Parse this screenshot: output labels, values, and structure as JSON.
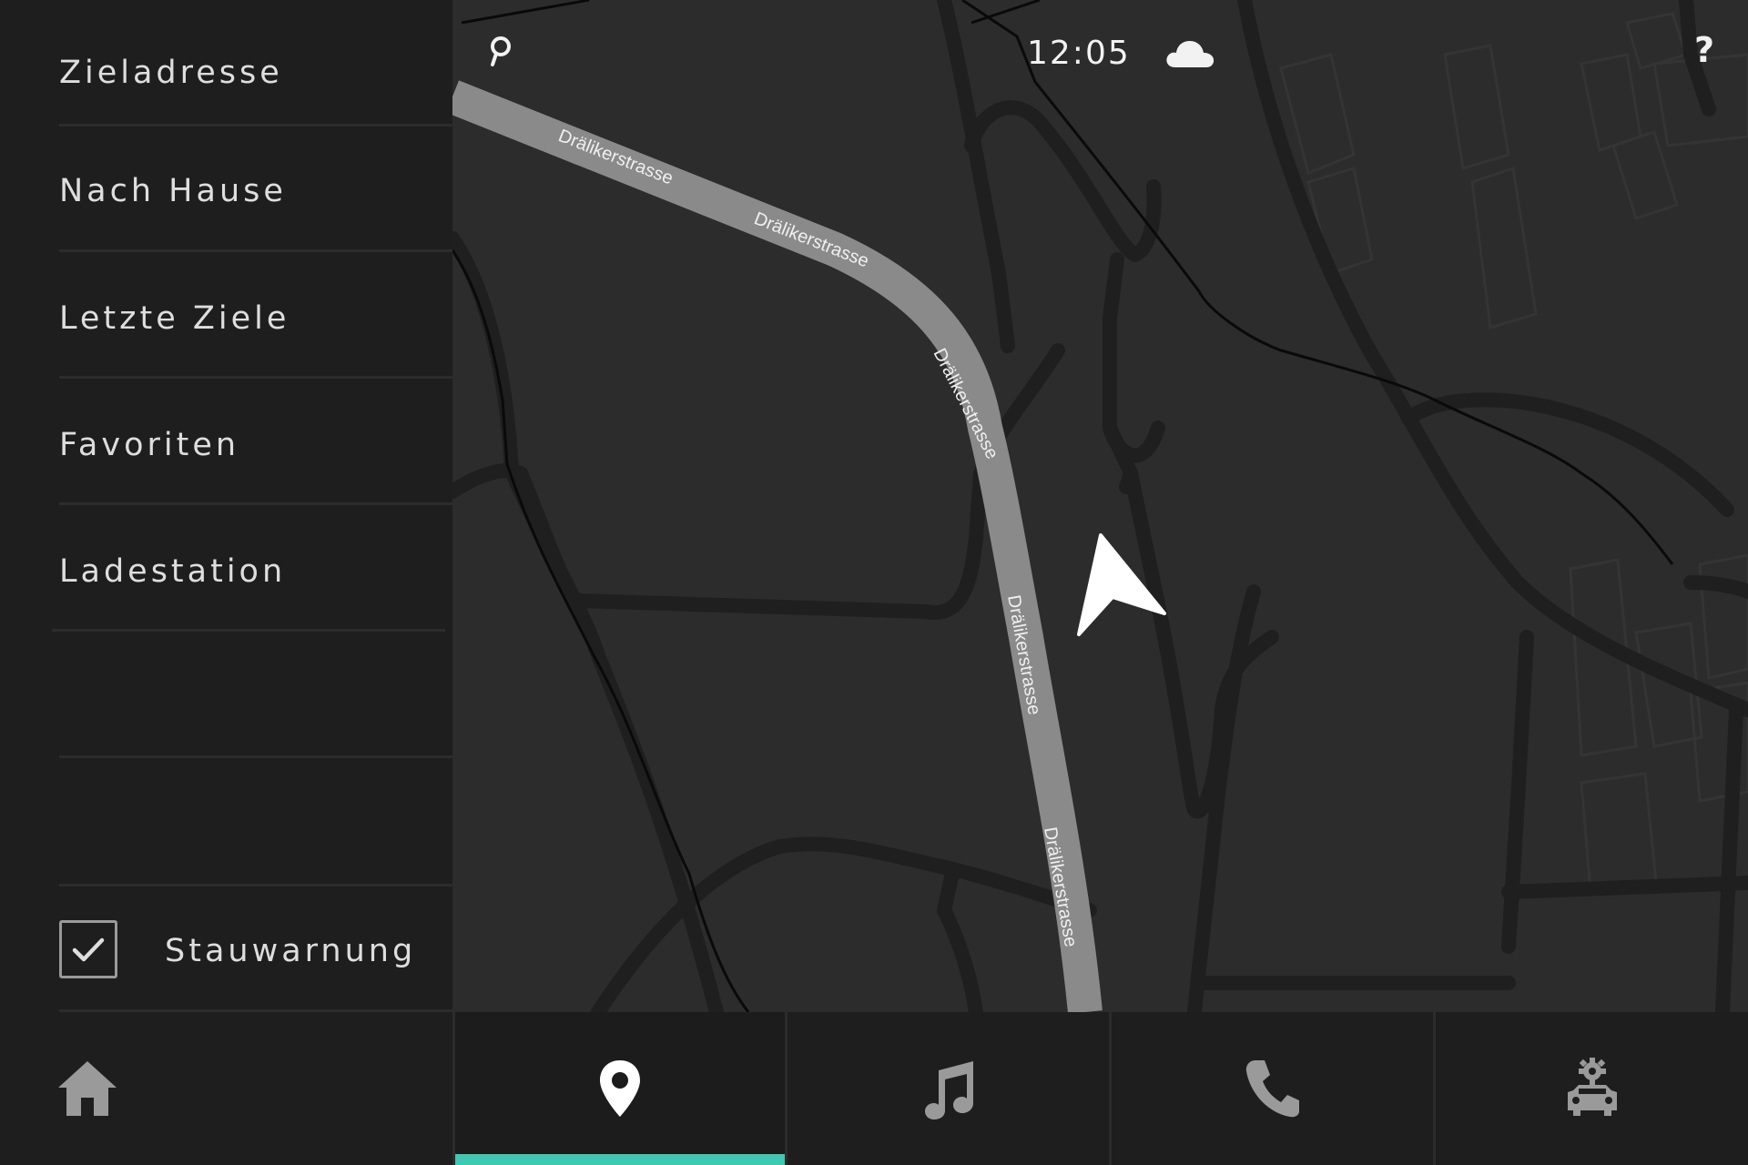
{
  "status": {
    "time": "12:05",
    "weather_icon": "cloud-icon",
    "search_icon": "search-icon",
    "help_label": "?"
  },
  "sidebar": {
    "items": [
      {
        "label": "Zieladresse"
      },
      {
        "label": "Nach Hause"
      },
      {
        "label": "Letzte Ziele"
      },
      {
        "label": "Favoriten"
      },
      {
        "label": "Ladestation"
      }
    ],
    "traffic_warning": {
      "label": "Stauwarnung",
      "checked": true
    }
  },
  "map": {
    "street_labels": [
      "Drälikerstrasse",
      "Drälikerstrasse",
      "Drälikerstrasse",
      "Drälikerstrasse",
      "Drälikerstrasse"
    ],
    "navigation_arrow_icon": "navigation-arrow-icon"
  },
  "bottom_nav": {
    "tabs": [
      {
        "name": "home",
        "icon": "home-icon",
        "active": false
      },
      {
        "name": "navigation",
        "icon": "location-pin-icon",
        "active": true
      },
      {
        "name": "media",
        "icon": "music-note-icon",
        "active": false
      },
      {
        "name": "phone",
        "icon": "phone-icon",
        "active": false
      },
      {
        "name": "vehicle-settings",
        "icon": "car-settings-icon",
        "active": false
      }
    ]
  },
  "colors": {
    "accent": "#3ec9b0",
    "background": "#1e1e1e",
    "map_background": "#2c2c2c",
    "route": "#8a8a8a",
    "text": "#dedede"
  }
}
